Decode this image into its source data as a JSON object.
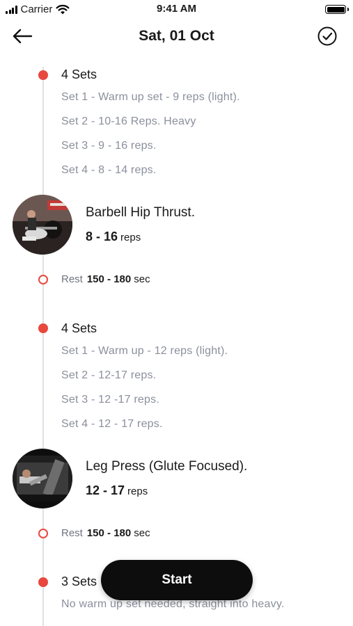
{
  "status_bar": {
    "carrier": "Carrier",
    "time": "9:41 AM",
    "battery_level": 1.0
  },
  "nav": {
    "title": "Sat, 01 Oct",
    "back_icon": "arrow-left-icon",
    "done_icon": "check-circle-icon"
  },
  "colors": {
    "accent": "#e8483e",
    "muted_text": "#8a8f9c",
    "primary_text": "#1a1a1a",
    "button_bg": "#0d0d0d"
  },
  "blocks": [
    {
      "sets_title": "4 Sets",
      "set_lines": [
        "Set 1 - Warm up set - 9 reps (light).",
        "Set 2 - 10-16 Reps. Heavy",
        "Set 3 - 9 - 16 reps.",
        "Set 4 - 8 - 14 reps."
      ],
      "exercise_name": "Barbell Hip Thrust.",
      "reps_value": "8 - 16",
      "reps_unit": "reps",
      "rest_label": "Rest",
      "rest_value": "150 - 180",
      "rest_unit": "sec"
    },
    {
      "sets_title": "4 Sets",
      "set_lines": [
        "Set 1 - Warm up - 12 reps (light).",
        "Set 2 - 12-17 reps.",
        "Set 3 - 12 -17 reps.",
        "Set 4 - 12 - 17 reps."
      ],
      "exercise_name": "Leg Press (Glute Focused).",
      "reps_value": "12 - 17",
      "reps_unit": "reps",
      "rest_label": "Rest",
      "rest_value": "150 - 180",
      "rest_unit": "sec"
    },
    {
      "sets_title": "3 Sets",
      "set_lines": [
        "No warm up set needed, straight into heavy."
      ]
    }
  ],
  "start_button": {
    "label": "Start"
  }
}
